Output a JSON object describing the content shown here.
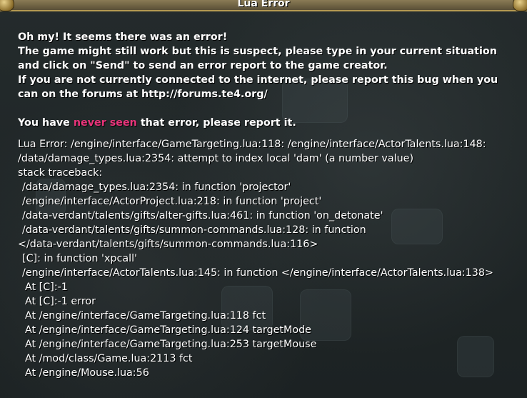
{
  "dialog": {
    "title": "Lua Error"
  },
  "message": {
    "line1": "Oh my! It seems there was an error!",
    "line2": "The game might still work but this is suspect, please type in your current situation",
    "line3": "and click on \"Send\" to send an error report to the game creator.",
    "line4": "If you are not currently connected to the internet, please report this bug when you",
    "line5": "can on the forums at http://forums.te4.org/",
    "seen_prefix": "You have ",
    "seen_highlight": "never seen",
    "seen_suffix": " that error, please report it."
  },
  "traceback": {
    "lines": [
      "Lua Error: /engine/interface/GameTargeting.lua:118: /engine/interface/ActorTalents.lua:148:",
      "/data/damage_types.lua:2354: attempt to index local 'dam' (a number value)",
      "stack traceback:",
      "/data/damage_types.lua:2354: in function 'projector'",
      "/engine/interface/ActorProject.lua:218: in function 'project'",
      "/data-verdant/talents/gifts/alter-gifts.lua:461: in function 'on_detonate'",
      "/data-verdant/talents/gifts/summon-commands.lua:128: in function",
      "</data-verdant/talents/gifts/summon-commands.lua:116>",
      "[C]: in function 'xpcall'",
      "/engine/interface/ActorTalents.lua:145: in function </engine/interface/ActorTalents.lua:138>",
      "At [C]:-1",
      "At [C]:-1 error",
      "At /engine/interface/GameTargeting.lua:118 fct",
      "At /engine/interface/GameTargeting.lua:124 targetMode",
      "At /engine/interface/GameTargeting.lua:253 targetMouse",
      "At /mod/class/Game.lua:2113 fct",
      "At /engine/Mouse.lua:56"
    ]
  },
  "colors": {
    "highlight": "#e8347a",
    "text": "#ffffff",
    "background": "#1f2526"
  }
}
